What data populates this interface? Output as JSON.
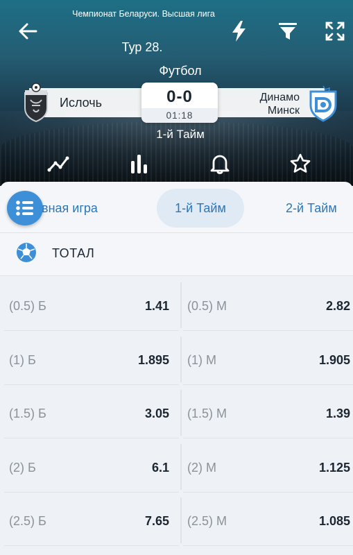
{
  "header": {
    "league": "Чемпионат Беларуси. Высшая лига",
    "round": "Тур 28.",
    "sport": "Футбол",
    "home_team": "Ислочь",
    "away_team_line1": "Динамо",
    "away_team_line2": "Минск",
    "score": "0-0",
    "time": "01:18",
    "period": "1-й Тайм"
  },
  "tabs": {
    "main_game": "овная игра",
    "first_half": "1-й Тайм",
    "second_half": "2-й Тайм",
    "active": "1-й Тайм"
  },
  "market": {
    "title": "ТОТАЛ",
    "rows": [
      {
        "over_label": "(0.5) Б",
        "over_odd": "1.41",
        "under_label": "(0.5) М",
        "under_odd": "2.82"
      },
      {
        "over_label": "(1) Б",
        "over_odd": "1.895",
        "under_label": "(1) М",
        "under_odd": "1.905"
      },
      {
        "over_label": "(1.5) Б",
        "over_odd": "3.05",
        "under_label": "(1.5) М",
        "under_odd": "1.39"
      },
      {
        "over_label": "(2) Б",
        "over_odd": "6.1",
        "under_label": "(2) М",
        "under_odd": "1.125"
      },
      {
        "over_label": "(2.5) Б",
        "over_odd": "7.65",
        "under_label": "(2.5) М",
        "under_odd": "1.085"
      }
    ]
  },
  "colors": {
    "accent": "#3d8fd8",
    "tab_text": "#2b76b9",
    "active_tab_bg": "#dfeaf5"
  },
  "icons": {
    "back": "arrow-left-icon",
    "bolt": "lightning-icon",
    "filter": "filter-icon",
    "expand": "expand-icon",
    "stats": "line-chart-icon",
    "bars": "bar-chart-icon",
    "bell": "bell-icon",
    "star": "star-icon",
    "list": "list-icon",
    "ball": "soccer-ball-icon"
  }
}
